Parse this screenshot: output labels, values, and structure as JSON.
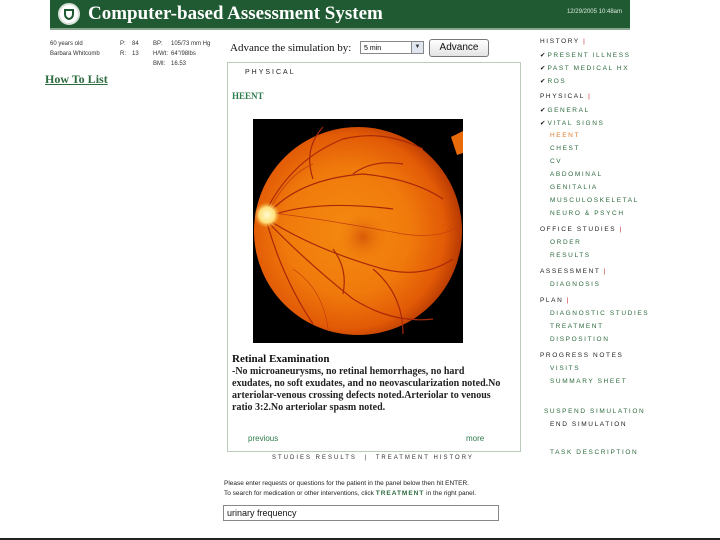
{
  "app": {
    "title": "Computer-based Assessment System",
    "timestamp": "12/29/2005 10:48am"
  },
  "patient": {
    "age": "60 years old",
    "name": "Barbara Whitcomb",
    "p_label": "P:",
    "p_value": "84",
    "r_label": "R:",
    "r_value": "13",
    "bp_label": "BP:",
    "bp_value": "105/73 mm Hg",
    "ht_label": "H/Wt:",
    "ht_value": "64\"/98lbs",
    "bmi_label": "BMI:",
    "bmi_value": "16.53"
  },
  "how_to_list": "How To List",
  "advance": {
    "label": "Advance the simulation by:",
    "selected": "5 min",
    "button": "Advance"
  },
  "panel": {
    "header": "PHYSICAL",
    "section": "HEENT",
    "exam_title": "Retinal Examination",
    "exam_text": "-No microaneurysms, no retinal hemorrhages, no hard exudates, no soft exudates, and no neovascularization noted.No arteriolar-venous crossing defects noted.Arteriolar to venous ratio 3:2.No arteriolar spasm noted.",
    "previous": "previous",
    "more": "more"
  },
  "bottom_tabs": {
    "studies": "STUDIES RESULTS",
    "sep": "|",
    "treatment": "TREATMENT HISTORY"
  },
  "instructions": {
    "line1": "Please enter requests or questions for the patient in the panel below then hit ENTER.",
    "line2_pre": "To search for medication or other interventions, click",
    "line2_link": "TREATMENT",
    "line2_post": "in the right panel."
  },
  "query_value": "urinary frequency",
  "nav": {
    "history": "HISTORY",
    "present_illness": "PRESENT ILLNESS",
    "past_medical": "PAST MEDICAL HX",
    "ros": "ROS",
    "physical": "PHYSICAL",
    "general": "GENERAL",
    "vital_signs": "VITAL SIGNS",
    "heent": "HEENT",
    "chest": "CHEST",
    "cv": "CV",
    "abdominal": "ABDOMINAL",
    "genitalia": "GENITALIA",
    "musculoskeletal": "MUSCULOSKELETAL",
    "neuro": "NEURO & PSYCH",
    "office_studies": "OFFICE STUDIES",
    "order": "ORDER",
    "results": "RESULTS",
    "assessment": "ASSESSMENT",
    "diagnosis": "DIAGNOSIS",
    "plan": "PLAN",
    "diag_studies": "DIAGNOSTIC STUDIES",
    "treatment": "TREATMENT",
    "disposition": "DISPOSITION",
    "progress_notes": "PROGRESS NOTES",
    "visits": "VISITS",
    "summary_sheet": "SUMMARY SHEET",
    "suspend": "SUSPEND SIMULATION",
    "end": "END SIMULATION",
    "task": "TASK DESCRIPTION"
  },
  "colors": {
    "header_bg": "#1f5a32",
    "nav_green": "#2d6b3e",
    "nav_active": "#e07a2a",
    "check_mark": "✔"
  }
}
